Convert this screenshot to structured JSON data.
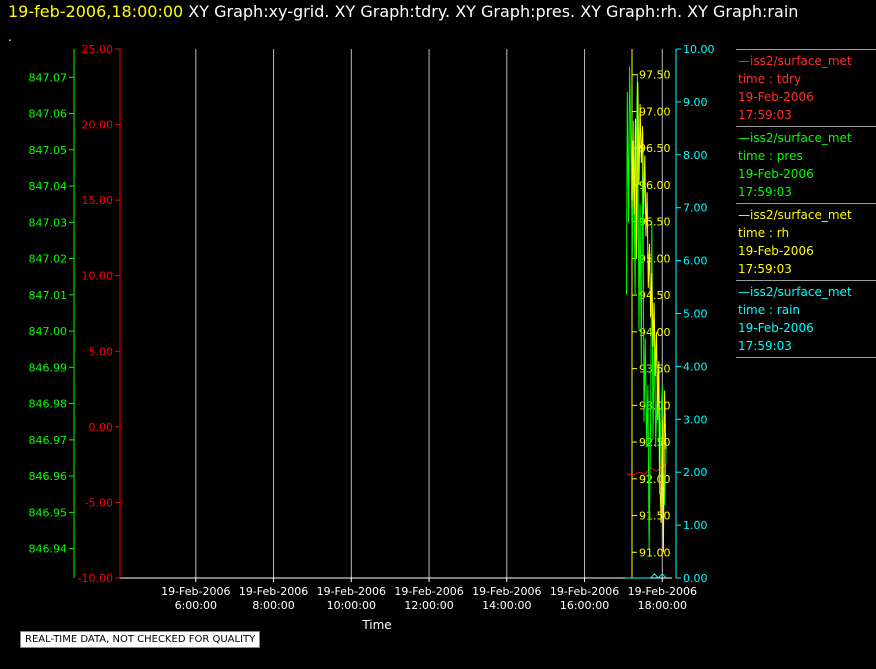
{
  "header": {
    "timestamp": "19-feb-2006,18:00:00",
    "graphs": [
      "XY Graph:xy-grid.",
      "XY Graph:tdry.",
      "XY Graph:pres.",
      "XY Graph:rh.",
      "XY Graph:rain"
    ],
    "dot": "."
  },
  "notice": "REAL-TIME DATA, NOT CHECKED FOR QUALITY",
  "colors": {
    "tdry": "#ff0000",
    "pres": "#00ff00",
    "rh": "#ffff00",
    "rain": "#00ffff",
    "grid": "#bbbbbb",
    "text": "#ffffff"
  },
  "chart_data": {
    "type": "line",
    "xlabel": "Time",
    "x_ticks": [
      [
        "19-Feb-2006",
        "6:00:00"
      ],
      [
        "19-Feb-2006",
        "8:00:00"
      ],
      [
        "19-Feb-2006",
        "10:00:00"
      ],
      [
        "19-Feb-2006",
        "12:00:00"
      ],
      [
        "19-Feb-2006",
        "14:00:00"
      ],
      [
        "19-Feb-2006",
        "16:00:00"
      ],
      [
        "19-Feb-2006",
        "18:00:00"
      ]
    ],
    "x_tick_hours": [
      6,
      8,
      10,
      12,
      14,
      16,
      18
    ],
    "xlim_hours": [
      4.05,
      18.25
    ],
    "grid": "vertical lines at x ticks",
    "axes": {
      "tdry": {
        "ticks": [
          "25.00",
          "20.00",
          "15.00",
          "10.00",
          "5.00",
          "0.00",
          "-5.00",
          "-10.00"
        ],
        "ylim": [
          -10,
          25
        ]
      },
      "pres": {
        "ticks": [
          "847.07",
          "847.06",
          "847.05",
          "847.04",
          "847.03",
          "847.02",
          "847.01",
          "847.00",
          "846.99",
          "846.98",
          "846.97",
          "846.96",
          "846.95",
          "846.94"
        ],
        "ylim": [
          846.9319,
          847.0778
        ]
      },
      "rh": {
        "ticks": [
          "97.50",
          "97.00",
          "96.50",
          "96.00",
          "95.50",
          "95.00",
          "94.50",
          "94.00",
          "93.50",
          "93.00",
          "92.50",
          "92.00",
          "91.50",
          "91.00"
        ],
        "ylim": [
          90.65,
          97.85
        ]
      },
      "rain": {
        "ticks": [
          "10.00",
          "9.00",
          "8.00",
          "7.00",
          "6.00",
          "5.00",
          "4.00",
          "3.00",
          "2.00",
          "1.00",
          "0.00"
        ],
        "ylim": [
          0,
          10
        ]
      }
    },
    "series": [
      {
        "name": "tdry",
        "color": "#ff0000",
        "x": [
          17.08,
          17.25,
          17.4,
          17.55,
          17.7,
          17.85,
          18.0,
          18.1
        ],
        "y": [
          -3.1,
          -3.2,
          -3.0,
          -3.15,
          -2.7,
          -2.95,
          -2.6,
          -2.45
        ]
      },
      {
        "name": "pres",
        "color": "#00ff00",
        "x": [
          17.08,
          17.1,
          17.13,
          17.16,
          17.2,
          17.23,
          17.26,
          17.3,
          17.33,
          17.36,
          17.4,
          17.43,
          17.46,
          17.5,
          17.53,
          17.56,
          17.6,
          17.63,
          17.66,
          17.7,
          17.73,
          17.76,
          17.8,
          17.83,
          17.86,
          17.9,
          17.93,
          17.96,
          18.0,
          18.03,
          18.06,
          18.1
        ],
        "y": [
          847.01,
          847.066,
          847.03,
          847.073,
          847.045,
          847.02,
          847.058,
          847.01,
          847.05,
          847.071,
          847.0,
          847.035,
          846.99,
          847.055,
          846.975,
          846.998,
          846.968,
          846.985,
          846.94,
          846.975,
          847.03,
          846.97,
          847.0,
          846.968,
          846.98,
          846.99,
          846.955,
          846.975,
          846.985,
          846.972,
          846.952,
          846.969
        ]
      },
      {
        "name": "rh",
        "color": "#ffff00",
        "x": [
          17.22,
          17.25,
          17.28,
          17.31,
          17.34,
          17.37,
          17.4,
          17.43,
          17.46,
          17.49,
          17.52,
          17.55,
          17.58,
          17.61,
          17.64,
          17.67,
          17.7,
          17.73,
          17.76,
          17.79,
          17.82,
          17.85,
          17.88,
          17.91,
          17.94,
          17.97,
          18.0,
          18.03,
          18.06,
          18.09
        ],
        "y": [
          95.8,
          96.6,
          95.6,
          96.9,
          95.0,
          97.4,
          96.0,
          97.1,
          96.3,
          96.8,
          95.6,
          96.4,
          95.3,
          95.9,
          94.6,
          95.2,
          94.2,
          94.8,
          93.8,
          94.4,
          93.4,
          94.0,
          92.8,
          93.6,
          92.0,
          91.4,
          92.8,
          91.0,
          93.2,
          92.4
        ]
      },
      {
        "name": "rain",
        "color": "#00ffff",
        "x": [
          17.05,
          17.3,
          17.55,
          17.7,
          17.8,
          17.9,
          18.0,
          18.1
        ],
        "y": [
          0.0,
          0.0,
          0.0,
          0.0,
          0.08,
          0.0,
          0.08,
          0.0
        ]
      }
    ],
    "legend": [
      {
        "line": "—iss2/surface_met",
        "var": "time : tdry",
        "date": "19-Feb-2006",
        "time": "17:59:03",
        "color": "#ff0000"
      },
      {
        "line": "—iss2/surface_met",
        "var": "time : pres",
        "date": "19-Feb-2006",
        "time": "17:59:03",
        "color": "#00ff00"
      },
      {
        "line": "—iss2/surface_met",
        "var": "time : rh",
        "date": "19-Feb-2006",
        "time": "17:59:03",
        "color": "#ffff00"
      },
      {
        "line": "—iss2/surface_met",
        "var": "time : rain",
        "date": "19-Feb-2006",
        "time": "17:59:03",
        "color": "#00ffff"
      }
    ],
    "legend_position": "right"
  }
}
